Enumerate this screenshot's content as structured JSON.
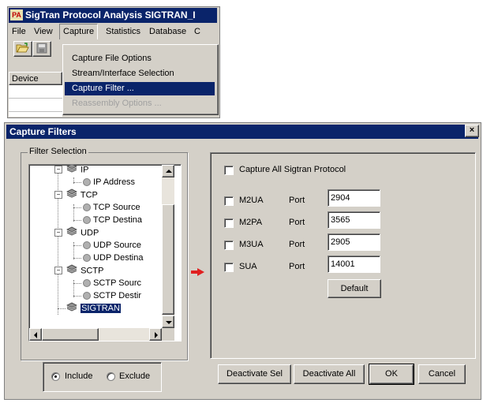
{
  "app": {
    "title": "SigTran Protocol Analysis SIGTRAN_I",
    "icon_text": "PA",
    "menu": [
      "File",
      "View",
      "Capture",
      "Statistics",
      "Database",
      "C"
    ],
    "grid_header": "Device",
    "dropdown": [
      {
        "label": "Capture File Options",
        "state": "normal"
      },
      {
        "label": "Stream/Interface Selection",
        "state": "normal"
      },
      {
        "label": "Capture Filter ...",
        "state": "selected"
      },
      {
        "label": "Reassembly Options ...",
        "state": "disabled"
      }
    ]
  },
  "dialog": {
    "title": "Capture Filters",
    "close_label": "×",
    "filter_group_label": "Filter Selection",
    "tree": [
      {
        "label": "IP",
        "level": 0
      },
      {
        "label": "IP Address",
        "level": 1
      },
      {
        "label": "TCP",
        "level": 0
      },
      {
        "label": "TCP Source",
        "level": 1
      },
      {
        "label": "TCP Destina",
        "level": 1
      },
      {
        "label": "UDP",
        "level": 0
      },
      {
        "label": "UDP Source",
        "level": 1
      },
      {
        "label": "UDP Destina",
        "level": 1
      },
      {
        "label": "SCTP",
        "level": 0
      },
      {
        "label": "SCTP Sourc",
        "level": 1
      },
      {
        "label": "SCTP Destir",
        "level": 1
      },
      {
        "label": "SIGTRAN",
        "level": 0,
        "selected": true
      }
    ],
    "include_label": "Include",
    "exclude_label": "Exclude",
    "include_selected": true,
    "capture_all_label": "Capture All Sigtran Protocol",
    "capture_all_checked": false,
    "protocols": [
      {
        "name": "M2UA",
        "port_label": "Port",
        "port": "2904",
        "checked": false
      },
      {
        "name": "M2PA",
        "port_label": "Port",
        "port": "3565",
        "checked": false
      },
      {
        "name": "M3UA",
        "port_label": "Port",
        "port": "2905",
        "checked": false
      },
      {
        "name": "SUA",
        "port_label": "Port",
        "port": "14001",
        "checked": false
      }
    ],
    "default_button": "Default",
    "buttons": {
      "deactivate_sel": "Deactivate Sel",
      "deactivate_all": "Deactivate All",
      "ok": "OK",
      "cancel": "Cancel"
    },
    "colors": {
      "title_bar": "#0a246a",
      "face": "#d4d0c8",
      "arrow": "#e02020"
    }
  }
}
